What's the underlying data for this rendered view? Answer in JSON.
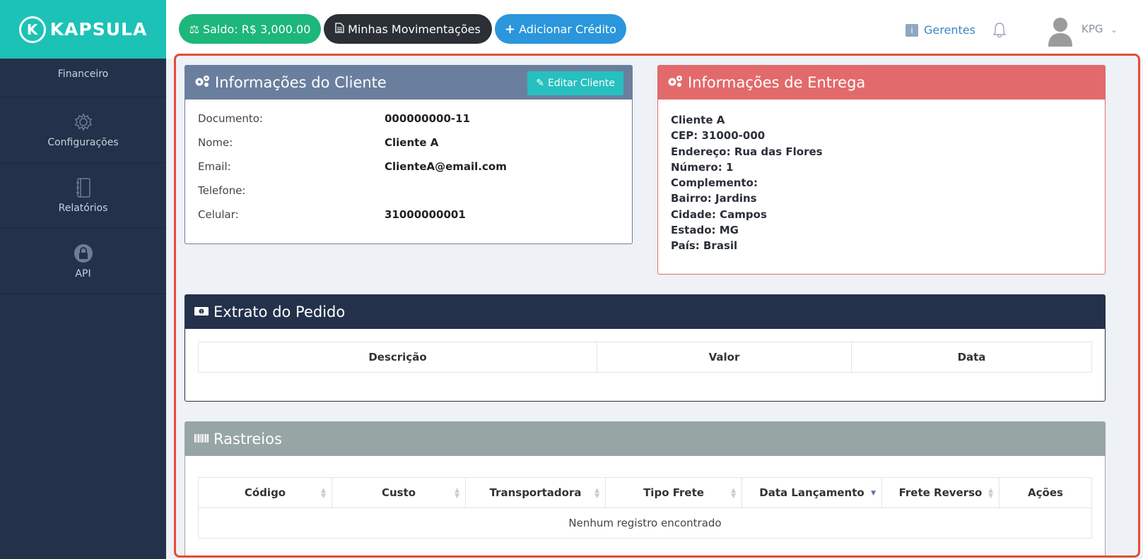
{
  "brand": {
    "name": "KAPSULA",
    "logo_letter": "K"
  },
  "sidebar": {
    "items": [
      {
        "label": "Financeiro",
        "icon": "dollar-icon"
      },
      {
        "label": "Configurações",
        "icon": "gear-icon"
      },
      {
        "label": "Relatórios",
        "icon": "notebook-icon"
      },
      {
        "label": "API",
        "icon": "lock-icon"
      }
    ]
  },
  "topbar": {
    "saldo": "Saldo: R$ 3,000.00",
    "movimentacoes": "Minhas Movimentações",
    "adicionar": "Adicionar Crédito",
    "gerentes": "Gerentes",
    "user": "KPG"
  },
  "cliente": {
    "title": "Informações do Cliente",
    "edit_label": "Editar Cliente",
    "rows": [
      {
        "label": "Documento:",
        "value": "000000000-11"
      },
      {
        "label": "Nome:",
        "value": "Cliente A"
      },
      {
        "label": "Email:",
        "value": "ClienteA@email.com"
      },
      {
        "label": "Telefone:",
        "value": ""
      },
      {
        "label": "Celular:",
        "value": "31000000001"
      }
    ]
  },
  "entrega": {
    "title": "Informações de Entrega",
    "lines": [
      "Cliente A",
      "CEP: 31000-000",
      "Endereço: Rua das Flores",
      "Número: 1",
      "Complemento:",
      "Bairro: Jardins",
      "Cidade: Campos",
      "Estado: MG",
      "País: Brasil"
    ]
  },
  "extrato": {
    "title": "Extrato do Pedido",
    "columns": [
      "Descrição",
      "Valor",
      "Data"
    ]
  },
  "rastreios": {
    "title": "Rastreios",
    "columns": [
      "Código",
      "Custo",
      "Transportadora",
      "Tipo Frete",
      "Data Lançamento",
      "Frete Reverso",
      "Ações"
    ],
    "empty": "Nenhum registro encontrado"
  },
  "colors": {
    "sidebar": "#23324a",
    "brand": "#1cc2b6",
    "saldo": "#1db67b",
    "adicionar": "#2b96db",
    "cliente_header": "#6a7f9e",
    "entrega_header": "#e36a6a",
    "rastreios_header": "#97a5a4",
    "frame": "#e44b3a"
  }
}
